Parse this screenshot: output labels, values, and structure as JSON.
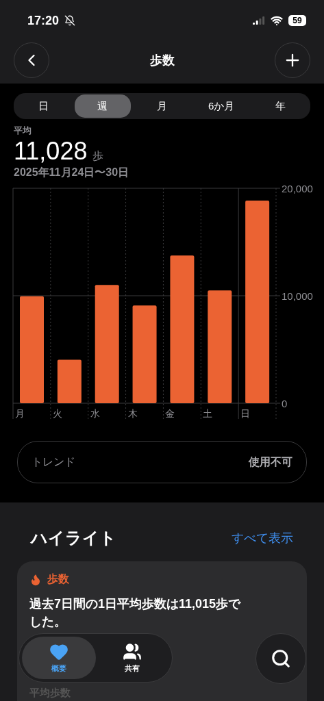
{
  "status_bar": {
    "time": "17:20",
    "battery": "59"
  },
  "header": {
    "title": "歩数"
  },
  "range_tabs": [
    {
      "label": "日",
      "selected": false
    },
    {
      "label": "週",
      "selected": true
    },
    {
      "label": "月",
      "selected": false
    },
    {
      "label": "6か月",
      "selected": false
    },
    {
      "label": "年",
      "selected": false
    }
  ],
  "summary": {
    "label": "平均",
    "value": "11,028",
    "unit": "歩",
    "date_range": "2025年11月24日〜30日"
  },
  "chart_data": {
    "type": "bar",
    "categories": [
      "月",
      "火",
      "水",
      "木",
      "金",
      "土",
      "日"
    ],
    "series": [
      {
        "color": "#eb6333",
        "values": [
          9950,
          4050,
          11000,
          9100,
          13750,
          10500,
          18850
        ]
      }
    ],
    "ylim": [
      0,
      20000
    ],
    "yticks": [
      {
        "value": 0,
        "label": "0"
      },
      {
        "value": 10000,
        "label": "10,000"
      },
      {
        "value": 20000,
        "label": "20,000"
      }
    ]
  },
  "trend": {
    "label": "トレンド",
    "value": "使用不可"
  },
  "highlights": {
    "title": "ハイライト",
    "show_all": "すべて表示",
    "card": {
      "category": "歩数",
      "text": "過去7日間の1日平均歩数は11,015歩でした。",
      "subtitle": "平均歩数"
    }
  },
  "tab_bar": [
    {
      "label": "概要",
      "selected": true
    },
    {
      "label": "共有",
      "selected": false
    }
  ]
}
